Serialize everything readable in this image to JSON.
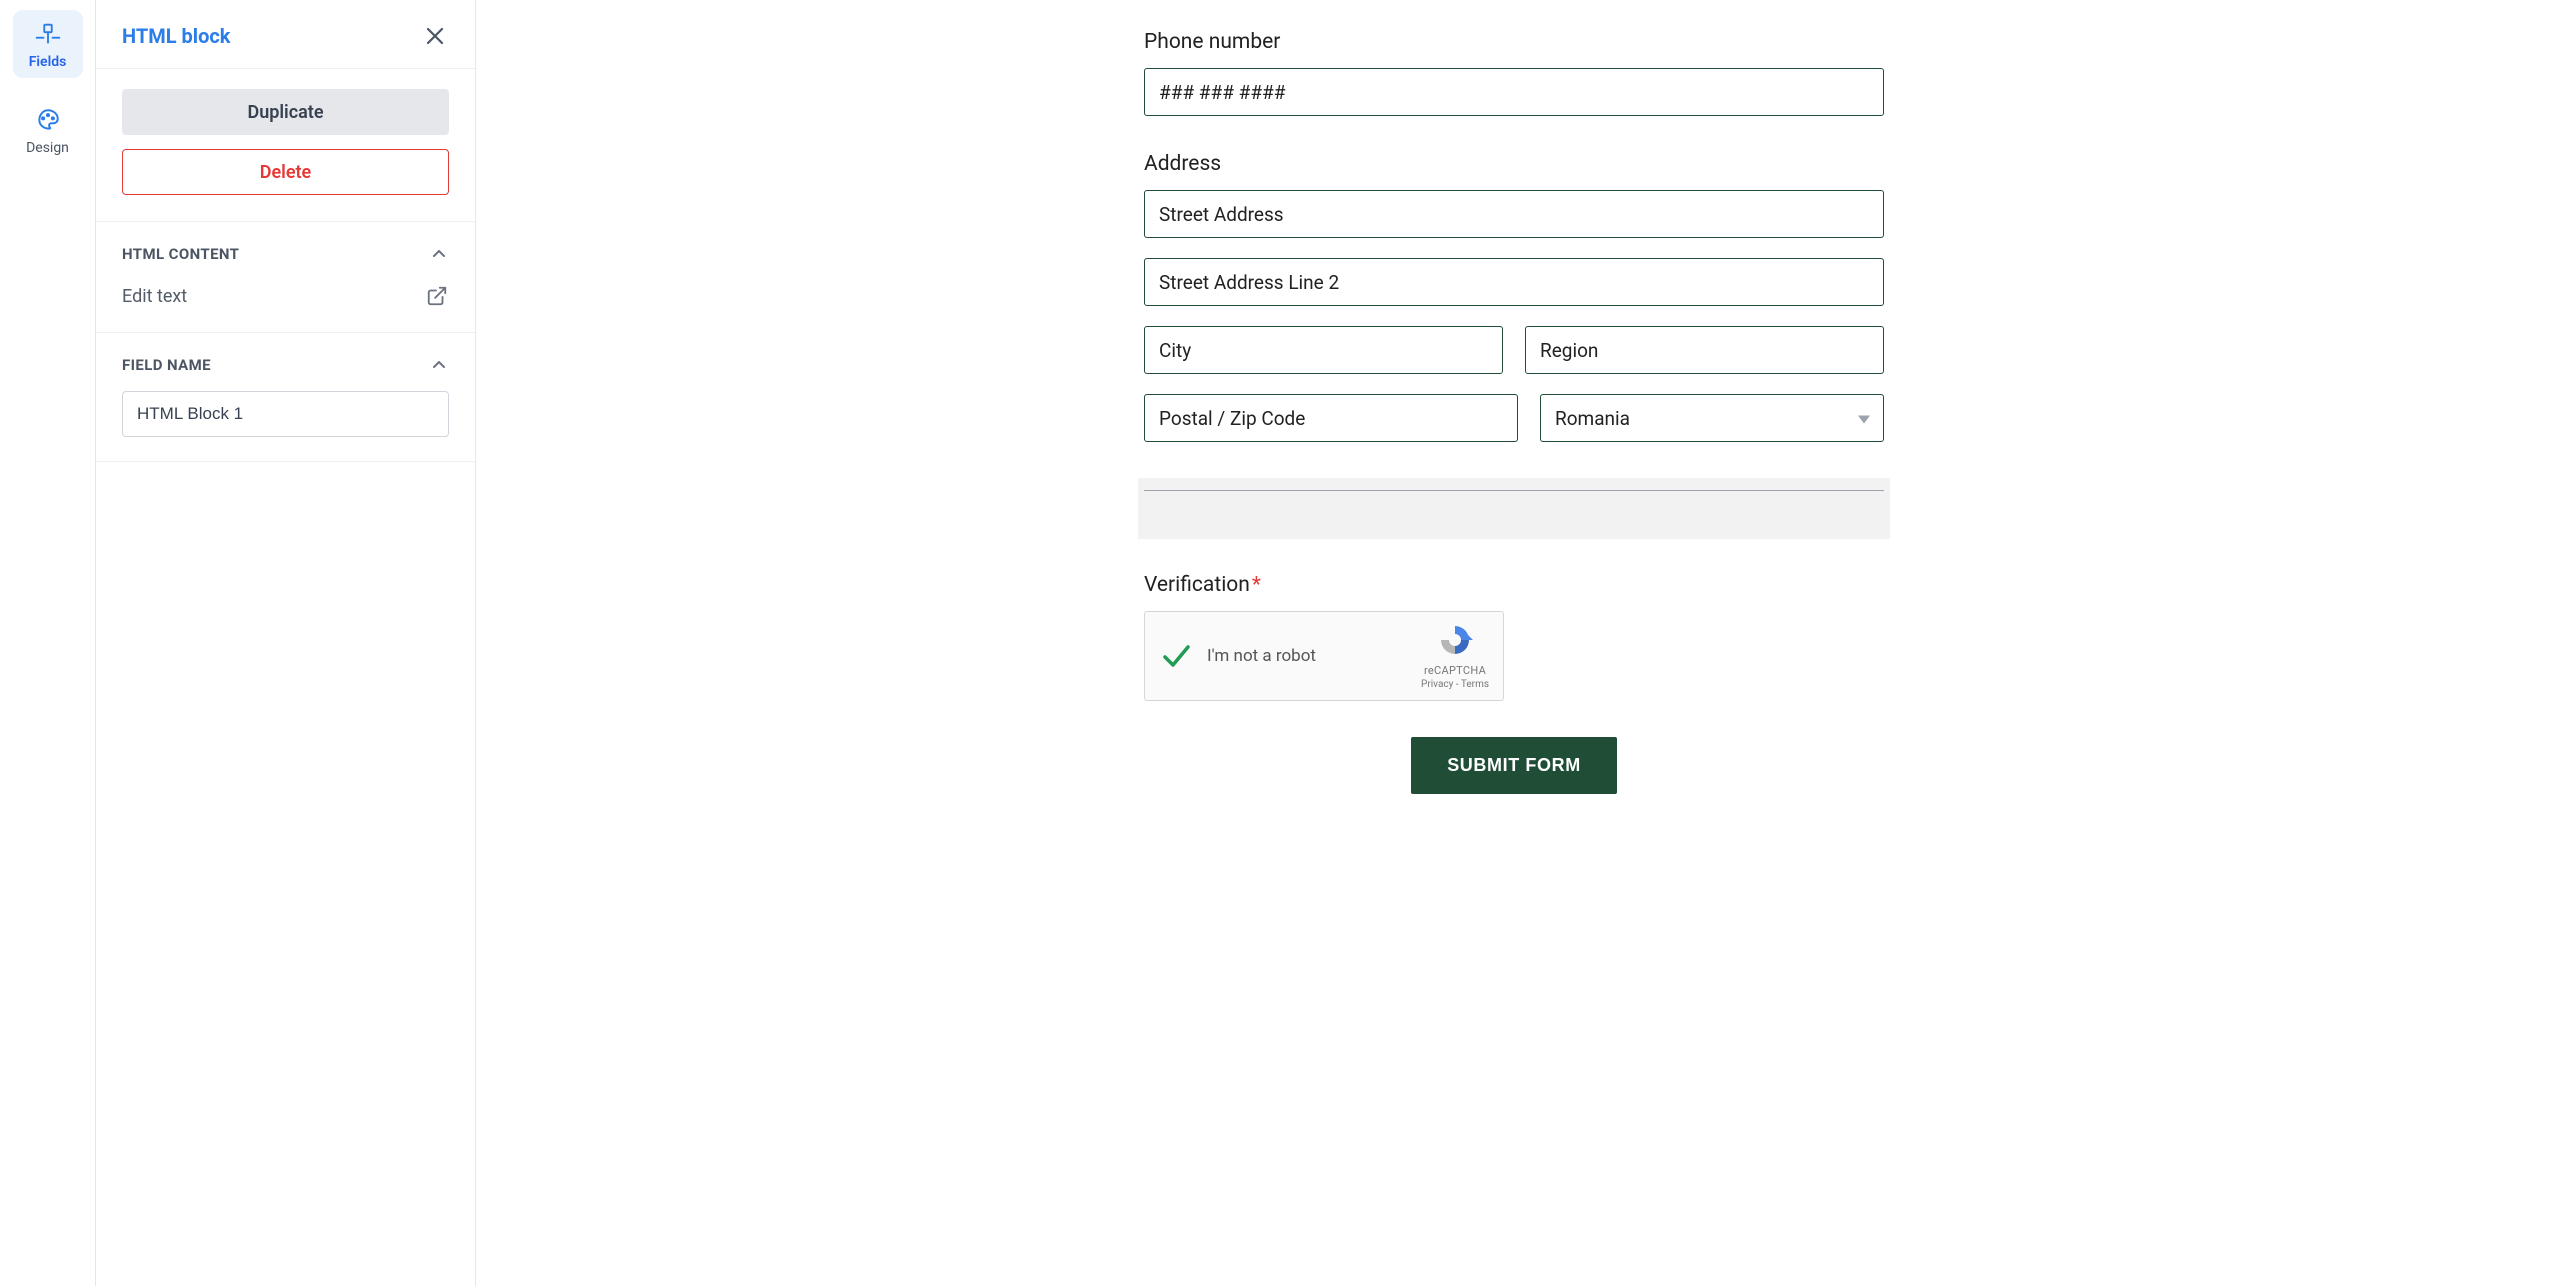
{
  "nav": {
    "fields_label": "Fields",
    "design_label": "Design"
  },
  "panel": {
    "title": "HTML block",
    "duplicate_label": "Duplicate",
    "delete_label": "Delete",
    "section_html_content": "HTML CONTENT",
    "edit_text_label": "Edit text",
    "section_field_name": "FIELD NAME",
    "field_name_value": "HTML Block 1"
  },
  "form": {
    "phone": {
      "label": "Phone number",
      "placeholder": "### ### ####"
    },
    "address": {
      "label": "Address",
      "street_placeholder": "Street Address",
      "street2_placeholder": "Street Address Line 2",
      "city_placeholder": "City",
      "region_placeholder": "Region",
      "postal_placeholder": "Postal / Zip Code",
      "country_value": "Romania"
    },
    "verification": {
      "label": "Verification",
      "required": "*",
      "not_robot": "I'm not a robot",
      "brand": "reCAPTCHA",
      "privacy": "Privacy",
      "terms": "Terms"
    },
    "submit_label": "SUBMIT FORM"
  }
}
